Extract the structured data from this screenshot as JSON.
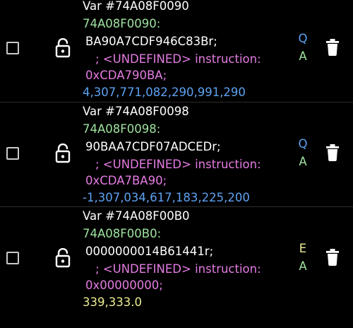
{
  "colors": {
    "background": "#000000",
    "white_text": "#ffffff",
    "address": "#9fe39f",
    "comment": "#e47ce2",
    "value_blue": "#5da2f2",
    "value_yellow": "#ecec92",
    "flag_q": "#5da2f2",
    "flag_a": "#9fe39f",
    "flag_e": "#ecec92"
  },
  "items": [
    {
      "title": "Var #74A08F0090",
      "address": "74A08F0090:",
      "opcode": "BA90A7CDF946C83Br;",
      "comment": "; <UNDEFINED> instruction:",
      "comment_value": "0xCDA790BA;",
      "value": "4,307,771,082,290,991,290",
      "flag_top": "Q",
      "flag_bottom": "A",
      "checkbox_icon": "checkbox-icon",
      "lock_icon": "lock-open-icon",
      "delete_icon": "trash-icon"
    },
    {
      "title": "Var #74A08F0098",
      "address": "74A08F0098:",
      "opcode": "90BAA7CDF07ADCEDr;",
      "comment": "; <UNDEFINED> instruction:",
      "comment_value": "0xCDA7BA90;",
      "value": "-1,307,034,617,183,225,200",
      "flag_top": "Q",
      "flag_bottom": "A",
      "checkbox_icon": "checkbox-icon",
      "lock_icon": "lock-open-icon",
      "delete_icon": "trash-icon"
    },
    {
      "title": "Var #74A08F00B0",
      "address": "74A08F00B0:",
      "opcode": "0000000014B61441r;",
      "comment": "; <UNDEFINED> instruction:",
      "comment_value": "0x00000000;",
      "value": "339,333.0",
      "flag_top": "E",
      "flag_bottom": "A",
      "checkbox_icon": "checkbox-icon",
      "lock_icon": "lock-open-icon",
      "delete_icon": "trash-icon"
    }
  ]
}
